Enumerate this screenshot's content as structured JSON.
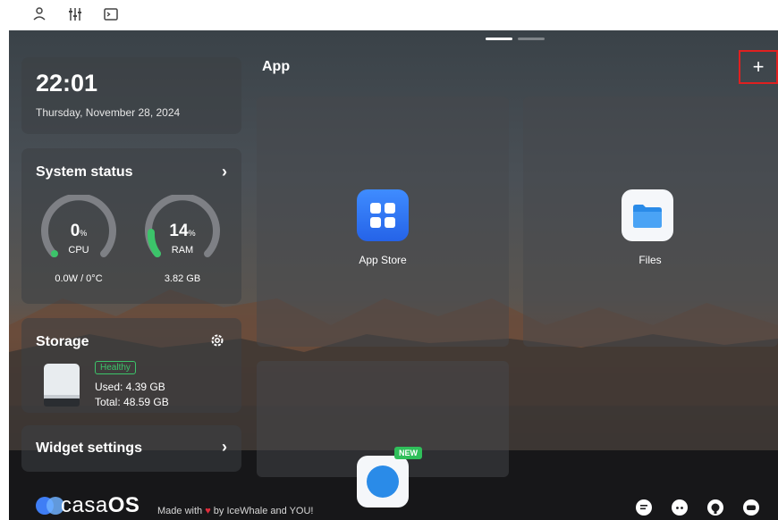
{
  "topbar": {
    "icons": [
      "user-icon",
      "sliders-icon",
      "terminal-icon"
    ]
  },
  "widgets": {
    "clock": {
      "time": "22:01",
      "date": "Thursday, November 28, 2024"
    },
    "system_status": {
      "title": "System status",
      "cpu": {
        "value": "0",
        "unit": "%",
        "label": "CPU",
        "detail": "0.0W / 0°C",
        "percent": 0
      },
      "ram": {
        "value": "14",
        "unit": "%",
        "label": "RAM",
        "detail": "3.82 GB",
        "percent": 14
      }
    },
    "storage": {
      "title": "Storage",
      "status": "Healthy",
      "used": "Used: 4.39 GB",
      "total": "Total: 48.59 GB"
    },
    "widget_settings": {
      "title": "Widget settings"
    }
  },
  "apps": {
    "section_title": "App",
    "add_label": "+",
    "items": [
      {
        "label": "App Store",
        "icon": "app-store-icon"
      },
      {
        "label": "Files",
        "icon": "files-icon"
      },
      {
        "label": "",
        "icon": "app-icon",
        "badge": "NEW"
      }
    ]
  },
  "footer": {
    "logo_text_light": "casa",
    "logo_text_bold": "OS",
    "made_with_prefix": "Made with ",
    "heart": "♥",
    "made_with_suffix": " by IceWhale and YOU!",
    "icons": [
      "forum-icon",
      "discord-icon",
      "github-icon",
      "chat-icon"
    ]
  },
  "colors": {
    "accent_green": "#3cc46a",
    "highlight_red": "#e02020",
    "app_store_blue": "#2f7bf5",
    "files_blue": "#2a8be8"
  }
}
